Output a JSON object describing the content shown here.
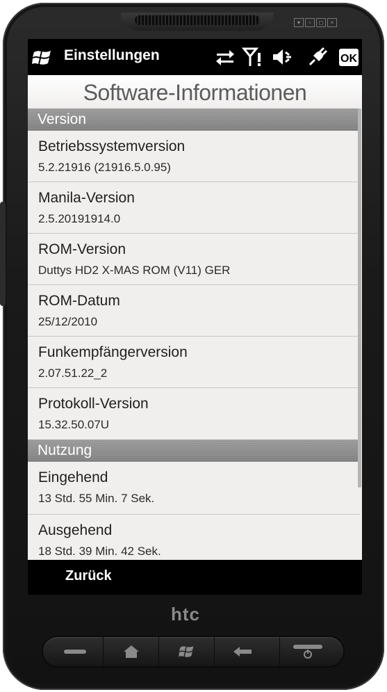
{
  "statusbar": {
    "title": "Einstellungen",
    "icons": [
      "windows-start-icon",
      "sync-arrows-icon",
      "signal-icon",
      "speaker-icon",
      "plug-icon",
      "ok-icon"
    ],
    "ok_label": "OK"
  },
  "page": {
    "title": "Software-Informationen"
  },
  "sections": {
    "version": {
      "header": "Version",
      "rows": [
        {
          "label": "Betriebssystemversion",
          "value": "5.2.21916 (21916.5.0.95)"
        },
        {
          "label": "Manila-Version",
          "value": "2.5.20191914.0"
        },
        {
          "label": "ROM-Version",
          "value": "Duttys HD2 X-MAS ROM (V11) GER"
        },
        {
          "label": "ROM-Datum",
          "value": "25/12/2010"
        },
        {
          "label": "Funkempfängerversion",
          "value": "2.07.51.22_2"
        },
        {
          "label": "Protokoll-Version",
          "value": "15.32.50.07U"
        }
      ]
    },
    "usage": {
      "header": "Nutzung",
      "rows": [
        {
          "label": "Eingehend",
          "value": "13 Std. 55 Min. 7 Sek."
        },
        {
          "label": "Ausgehend",
          "value": "18 Std. 39 Min. 42 Sek."
        }
      ]
    }
  },
  "softkeys": {
    "left": "Zurück"
  },
  "device": {
    "brand": "htc",
    "hardware_keys": [
      "call-icon",
      "home-icon",
      "windows-icon",
      "back-arrow-icon",
      "end-call-icon"
    ]
  }
}
